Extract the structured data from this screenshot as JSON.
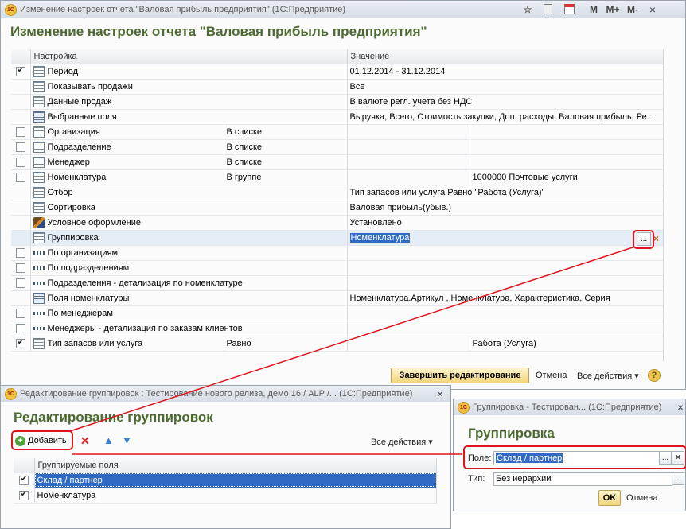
{
  "main": {
    "window_title": "Изменение настроек отчета \"Валовая прибыль предприятия\"  (1С:Предприятие)",
    "form_title": "Изменение настроек отчета \"Валовая прибыль предприятия\"",
    "toolbar_icons": [
      "M",
      "M+",
      "M-"
    ],
    "columns": [
      "Настройка",
      "Значение"
    ],
    "rows": [
      {
        "check": "on",
        "icon": "table-icon",
        "name": "Период",
        "value": "01.12.2014 - 31.12.2014"
      },
      {
        "check": "",
        "icon": "table-icon",
        "name": "Показывать продажи",
        "value": "Все"
      },
      {
        "check": "",
        "icon": "table-icon",
        "name": "Данные продаж",
        "value": "В валюте регл. учета без НДС"
      },
      {
        "check": "",
        "icon": "list-icon",
        "name": "Выбранные поля",
        "value": "Выручка, Всего, Стоимость закупки, Доп. расходы, Валовая прибыль, Ре..."
      },
      {
        "check": "off",
        "icon": "table-icon",
        "name": "Организация",
        "cond": "В списке",
        "value": ""
      },
      {
        "check": "off",
        "icon": "table-icon",
        "name": "Подразделение",
        "cond": "В списке",
        "value": ""
      },
      {
        "check": "off",
        "icon": "table-icon",
        "name": "Менеджер",
        "cond": "В списке",
        "value": ""
      },
      {
        "check": "off",
        "icon": "table-icon",
        "name": "Номенклатура",
        "cond": "В группе",
        "value": "1000000 Почтовые услуги"
      },
      {
        "check": "",
        "icon": "table-icon",
        "name": "Отбор",
        "value": "Тип запасов или услуга Равно \"Работа (Услуга)\""
      },
      {
        "check": "",
        "icon": "table-icon",
        "name": "Сортировка",
        "value": "Валовая прибыль(убыв.)"
      },
      {
        "check": "",
        "icon": "brush-icon",
        "name": "Условное оформление",
        "value": "Установлено"
      },
      {
        "check": "",
        "icon": "table-icon",
        "name": "Группировка",
        "value": "Номенклатура",
        "selected": true
      },
      {
        "check": "off",
        "icon": "dots-icon",
        "name": "По организациям",
        "value": ""
      },
      {
        "check": "off",
        "icon": "dots-icon",
        "name": "По подразделениям",
        "value": ""
      },
      {
        "check": "off",
        "icon": "dots-icon",
        "name": "Подразделения - детализация по номенклатуре",
        "value": ""
      },
      {
        "check": "",
        "icon": "list-icon",
        "name": "Поля номенклатуры",
        "value": "Номенклатура.Артикул , Номенклатура, Характеристика, Серия"
      },
      {
        "check": "off",
        "icon": "dots-icon",
        "name": "По менеджерам",
        "value": ""
      },
      {
        "check": "off",
        "icon": "dots-icon",
        "name": "Менеджеры - детализация по заказам клиентов",
        "value": ""
      },
      {
        "check": "on",
        "icon": "table-icon",
        "name": "Тип запасов или услуга",
        "cond": "Равно",
        "value": "Работа (Услуга)"
      }
    ],
    "finish_button": "Завершить редактирование",
    "cancel_link": "Отмена",
    "all_actions": "Все действия",
    "help": "?"
  },
  "grouping_editor": {
    "window_title": "Редактирование группировок : Тестирование нового релиза, демо 16 / ALP /...  (1С:Предприятие)",
    "form_title": "Редактирование группировок",
    "add_button": "Добавить",
    "all_actions": "Все действия",
    "column": "Группируемые поля",
    "rows": [
      {
        "check": "on",
        "name": "Склад / партнер",
        "selected": true
      },
      {
        "check": "on",
        "name": "Номенклатура"
      }
    ]
  },
  "grouping_dialog": {
    "window_title": "Группировка - Тестирован...  (1С:Предприятие)",
    "form_title": "Группировка",
    "field_label": "Поле:",
    "field_value": "Склад / партнер",
    "type_label": "Тип:",
    "type_value": "Без иерархии",
    "ok_button": "OK",
    "cancel_link": "Отмена"
  },
  "colors": {
    "accent_title": "#4b6a30",
    "highlight": "#e0141e",
    "selection": "#316ac5"
  }
}
